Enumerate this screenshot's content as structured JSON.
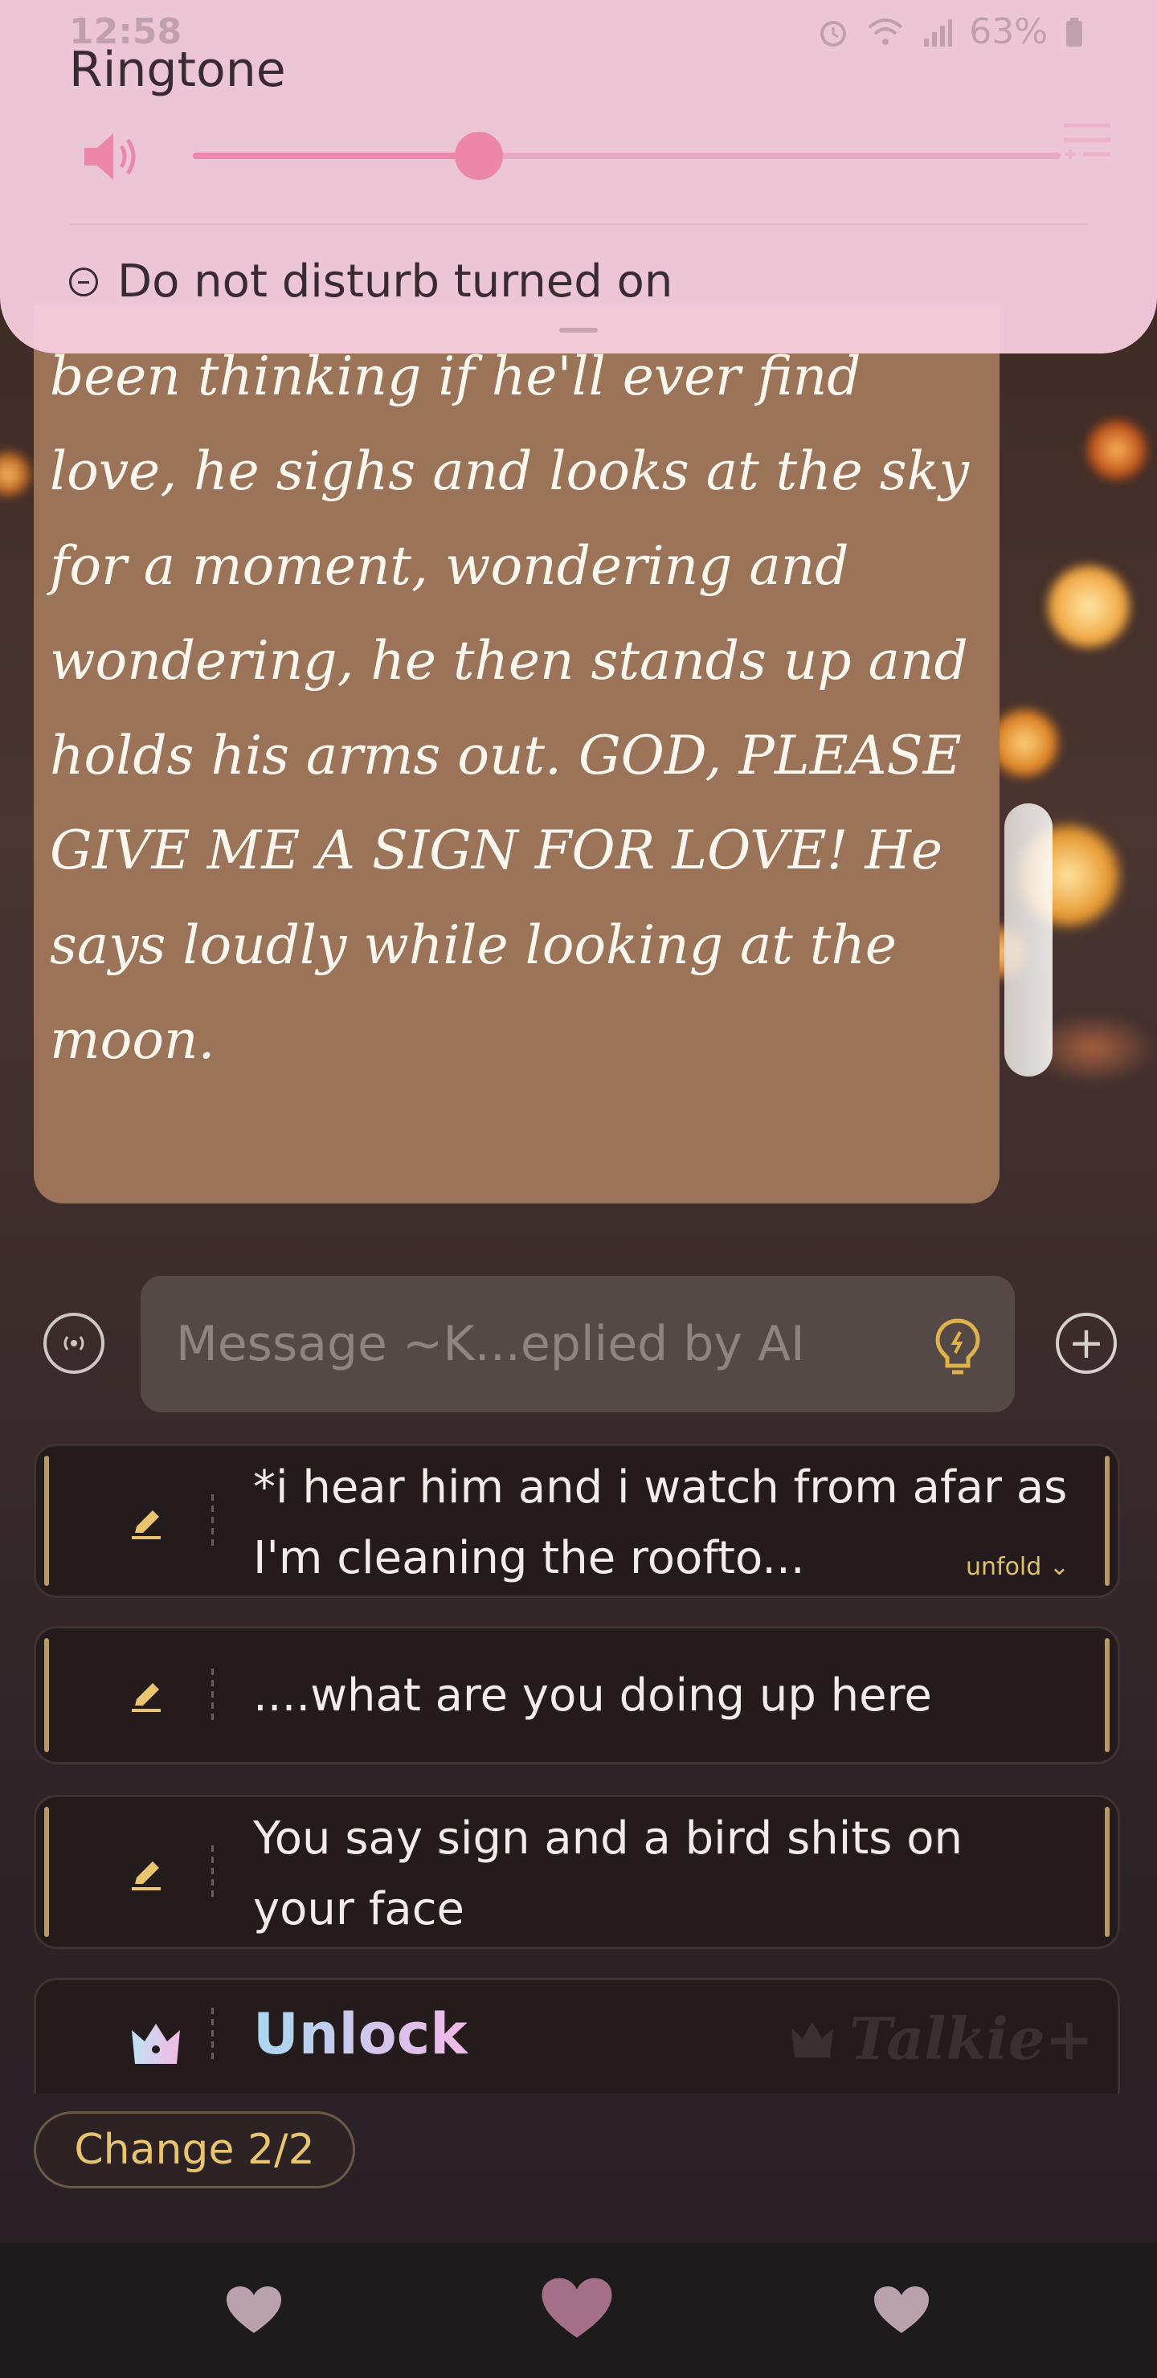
{
  "status_bar": {
    "time": "12:58",
    "battery": "63%",
    "icons": [
      "alarm-icon",
      "wifi-icon",
      "signal-icon",
      "battery-icon"
    ]
  },
  "volume_panel": {
    "title": "Ringtone",
    "volume_level": 0.33,
    "dnd_text": "Do not disturb turned on",
    "accent_color": "#f48bb0"
  },
  "story": {
    "text": "been thinking if he'll ever find love, he sighs and looks at the sky for a moment, wondering and wondering, he then stands up and holds his arms out. GOD, PLEASE GIVE ME A SIGN FOR LOVE!  He says loudly while looking at the moon."
  },
  "composer": {
    "placeholder": "Message ~K...eplied by AI"
  },
  "suggestions": [
    {
      "text": "*i hear him and i watch from afar as I'm cleaning the roofto...",
      "unfold_label": "unfold"
    },
    {
      "text": "....what are you doing up here"
    },
    {
      "text": "You say sign and a bird shits on your face"
    }
  ],
  "unlock_card": {
    "label": "Unlock",
    "brand": "Talkie+"
  },
  "change_button": {
    "label": "Change 2/2"
  },
  "bottom_nav": {
    "icons": [
      "heart-icon",
      "heart-icon",
      "heart-icon"
    ]
  }
}
